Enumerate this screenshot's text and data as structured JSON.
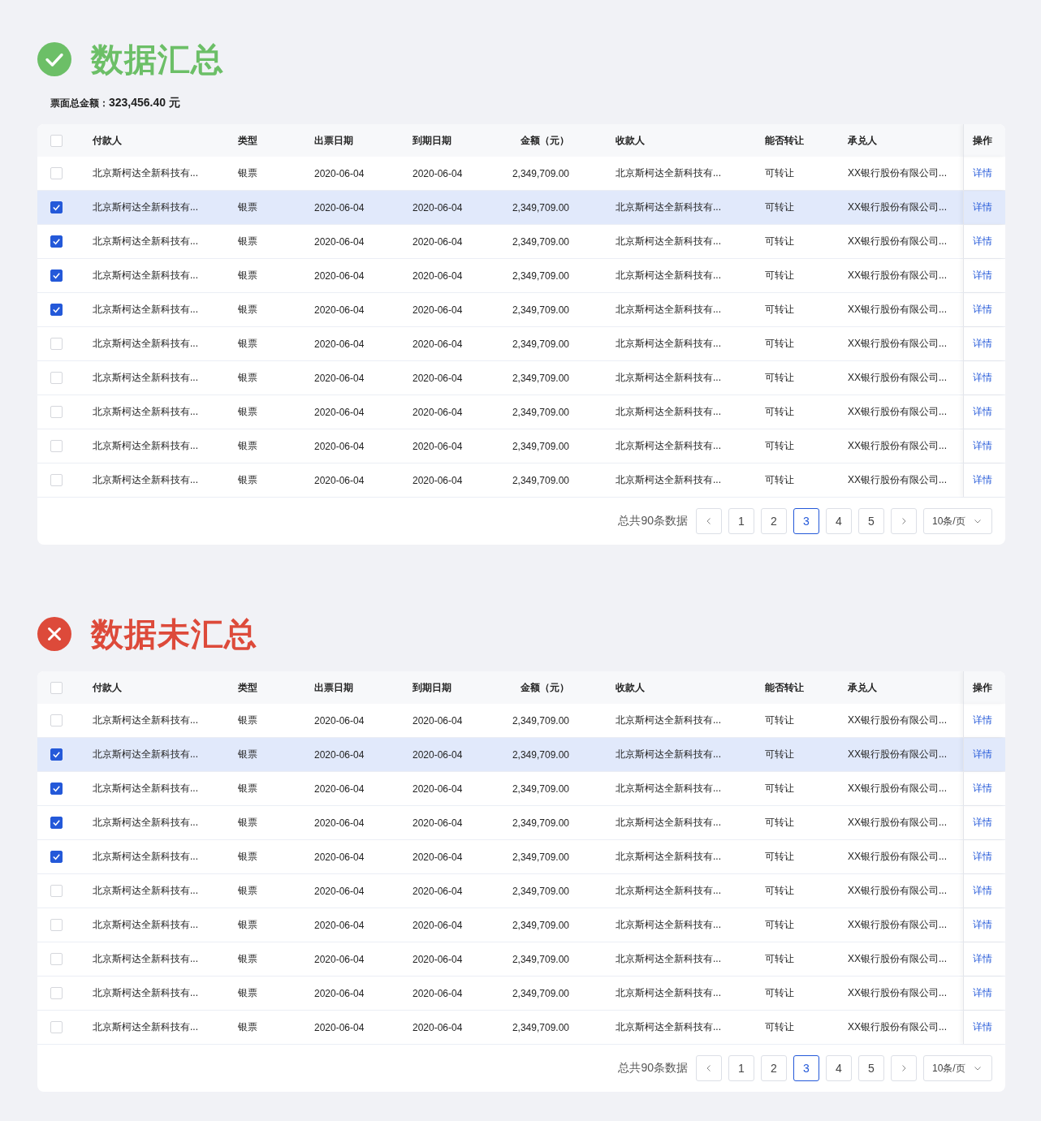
{
  "sections": [
    {
      "kind": "success",
      "title": "数据汇总",
      "summary": {
        "label": "票面总金额：",
        "value": "323,456.40 元"
      },
      "table": {
        "header_checked": false,
        "columns": [
          {
            "label": "付款人",
            "kind": "text"
          },
          {
            "label": "类型",
            "kind": "text"
          },
          {
            "label": "出票日期",
            "kind": "text"
          },
          {
            "label": "到期日期",
            "kind": "text"
          },
          {
            "label": "金额（元）",
            "kind": "amount"
          },
          {
            "label": "收款人",
            "kind": "text"
          },
          {
            "label": "能否转让",
            "kind": "text"
          },
          {
            "label": "承兑人",
            "kind": "text"
          },
          {
            "label": "操作",
            "kind": "action"
          }
        ],
        "rows": [
          {
            "checked": false,
            "hovered": false,
            "cells": [
              "北京斯柯达全新科技有...",
              "银票",
              "2020-06-04",
              "2020-06-04",
              "2,349,709.00",
              "北京斯柯达全新科技有...",
              "可转让",
              "XX银行股份有限公司...",
              "详情"
            ]
          },
          {
            "checked": true,
            "hovered": true,
            "cells": [
              "北京斯柯达全新科技有...",
              "银票",
              "2020-06-04",
              "2020-06-04",
              "2,349,709.00",
              "北京斯柯达全新科技有...",
              "可转让",
              "XX银行股份有限公司...",
              "详情"
            ]
          },
          {
            "checked": true,
            "hovered": false,
            "cells": [
              "北京斯柯达全新科技有...",
              "银票",
              "2020-06-04",
              "2020-06-04",
              "2,349,709.00",
              "北京斯柯达全新科技有...",
              "可转让",
              "XX银行股份有限公司...",
              "详情"
            ]
          },
          {
            "checked": true,
            "hovered": false,
            "cells": [
              "北京斯柯达全新科技有...",
              "银票",
              "2020-06-04",
              "2020-06-04",
              "2,349,709.00",
              "北京斯柯达全新科技有...",
              "可转让",
              "XX银行股份有限公司...",
              "详情"
            ]
          },
          {
            "checked": true,
            "hovered": false,
            "cells": [
              "北京斯柯达全新科技有...",
              "银票",
              "2020-06-04",
              "2020-06-04",
              "2,349,709.00",
              "北京斯柯达全新科技有...",
              "可转让",
              "XX银行股份有限公司...",
              "详情"
            ]
          },
          {
            "checked": false,
            "hovered": false,
            "cells": [
              "北京斯柯达全新科技有...",
              "银票",
              "2020-06-04",
              "2020-06-04",
              "2,349,709.00",
              "北京斯柯达全新科技有...",
              "可转让",
              "XX银行股份有限公司...",
              "详情"
            ]
          },
          {
            "checked": false,
            "hovered": false,
            "cells": [
              "北京斯柯达全新科技有...",
              "银票",
              "2020-06-04",
              "2020-06-04",
              "2,349,709.00",
              "北京斯柯达全新科技有...",
              "可转让",
              "XX银行股份有限公司...",
              "详情"
            ]
          },
          {
            "checked": false,
            "hovered": false,
            "cells": [
              "北京斯柯达全新科技有...",
              "银票",
              "2020-06-04",
              "2020-06-04",
              "2,349,709.00",
              "北京斯柯达全新科技有...",
              "可转让",
              "XX银行股份有限公司...",
              "详情"
            ]
          },
          {
            "checked": false,
            "hovered": false,
            "cells": [
              "北京斯柯达全新科技有...",
              "银票",
              "2020-06-04",
              "2020-06-04",
              "2,349,709.00",
              "北京斯柯达全新科技有...",
              "可转让",
              "XX银行股份有限公司...",
              "详情"
            ]
          },
          {
            "checked": false,
            "hovered": false,
            "cells": [
              "北京斯柯达全新科技有...",
              "银票",
              "2020-06-04",
              "2020-06-04",
              "2,349,709.00",
              "北京斯柯达全新科技有...",
              "可转让",
              "XX银行股份有限公司...",
              "详情"
            ]
          }
        ]
      },
      "pagination": {
        "total": "总共90条数据",
        "pages": [
          {
            "label": "1",
            "selected": false
          },
          {
            "label": "2",
            "selected": false
          },
          {
            "label": "3",
            "selected": true
          },
          {
            "label": "4",
            "selected": false
          },
          {
            "label": "5",
            "selected": false
          }
        ],
        "page_size": "10条/页"
      }
    },
    {
      "kind": "error",
      "title": "数据未汇总",
      "table": {
        "header_checked": false,
        "columns": [
          {
            "label": "付款人",
            "kind": "text"
          },
          {
            "label": "类型",
            "kind": "text"
          },
          {
            "label": "出票日期",
            "kind": "text"
          },
          {
            "label": "到期日期",
            "kind": "text"
          },
          {
            "label": "金额（元）",
            "kind": "amount"
          },
          {
            "label": "收款人",
            "kind": "text"
          },
          {
            "label": "能否转让",
            "kind": "text"
          },
          {
            "label": "承兑人",
            "kind": "text"
          },
          {
            "label": "操作",
            "kind": "action"
          }
        ],
        "rows": [
          {
            "checked": false,
            "hovered": false,
            "cells": [
              "北京斯柯达全新科技有...",
              "银票",
              "2020-06-04",
              "2020-06-04",
              "2,349,709.00",
              "北京斯柯达全新科技有...",
              "可转让",
              "XX银行股份有限公司...",
              "详情"
            ]
          },
          {
            "checked": true,
            "hovered": true,
            "cells": [
              "北京斯柯达全新科技有...",
              "银票",
              "2020-06-04",
              "2020-06-04",
              "2,349,709.00",
              "北京斯柯达全新科技有...",
              "可转让",
              "XX银行股份有限公司...",
              "详情"
            ]
          },
          {
            "checked": true,
            "hovered": false,
            "cells": [
              "北京斯柯达全新科技有...",
              "银票",
              "2020-06-04",
              "2020-06-04",
              "2,349,709.00",
              "北京斯柯达全新科技有...",
              "可转让",
              "XX银行股份有限公司...",
              "详情"
            ]
          },
          {
            "checked": true,
            "hovered": false,
            "cells": [
              "北京斯柯达全新科技有...",
              "银票",
              "2020-06-04",
              "2020-06-04",
              "2,349,709.00",
              "北京斯柯达全新科技有...",
              "可转让",
              "XX银行股份有限公司...",
              "详情"
            ]
          },
          {
            "checked": true,
            "hovered": false,
            "cells": [
              "北京斯柯达全新科技有...",
              "银票",
              "2020-06-04",
              "2020-06-04",
              "2,349,709.00",
              "北京斯柯达全新科技有...",
              "可转让",
              "XX银行股份有限公司...",
              "详情"
            ]
          },
          {
            "checked": false,
            "hovered": false,
            "cells": [
              "北京斯柯达全新科技有...",
              "银票",
              "2020-06-04",
              "2020-06-04",
              "2,349,709.00",
              "北京斯柯达全新科技有...",
              "可转让",
              "XX银行股份有限公司...",
              "详情"
            ]
          },
          {
            "checked": false,
            "hovered": false,
            "cells": [
              "北京斯柯达全新科技有...",
              "银票",
              "2020-06-04",
              "2020-06-04",
              "2,349,709.00",
              "北京斯柯达全新科技有...",
              "可转让",
              "XX银行股份有限公司...",
              "详情"
            ]
          },
          {
            "checked": false,
            "hovered": false,
            "cells": [
              "北京斯柯达全新科技有...",
              "银票",
              "2020-06-04",
              "2020-06-04",
              "2,349,709.00",
              "北京斯柯达全新科技有...",
              "可转让",
              "XX银行股份有限公司...",
              "详情"
            ]
          },
          {
            "checked": false,
            "hovered": false,
            "cells": [
              "北京斯柯达全新科技有...",
              "银票",
              "2020-06-04",
              "2020-06-04",
              "2,349,709.00",
              "北京斯柯达全新科技有...",
              "可转让",
              "XX银行股份有限公司...",
              "详情"
            ]
          },
          {
            "checked": false,
            "hovered": false,
            "cells": [
              "北京斯柯达全新科技有...",
              "银票",
              "2020-06-04",
              "2020-06-04",
              "2,349,709.00",
              "北京斯柯达全新科技有...",
              "可转让",
              "XX银行股份有限公司...",
              "详情"
            ]
          }
        ]
      },
      "pagination": {
        "total": "总共90条数据",
        "pages": [
          {
            "label": "1",
            "selected": false
          },
          {
            "label": "2",
            "selected": false
          },
          {
            "label": "3",
            "selected": true
          },
          {
            "label": "4",
            "selected": false
          },
          {
            "label": "5",
            "selected": false
          }
        ],
        "page_size": "10条/页"
      }
    }
  ]
}
